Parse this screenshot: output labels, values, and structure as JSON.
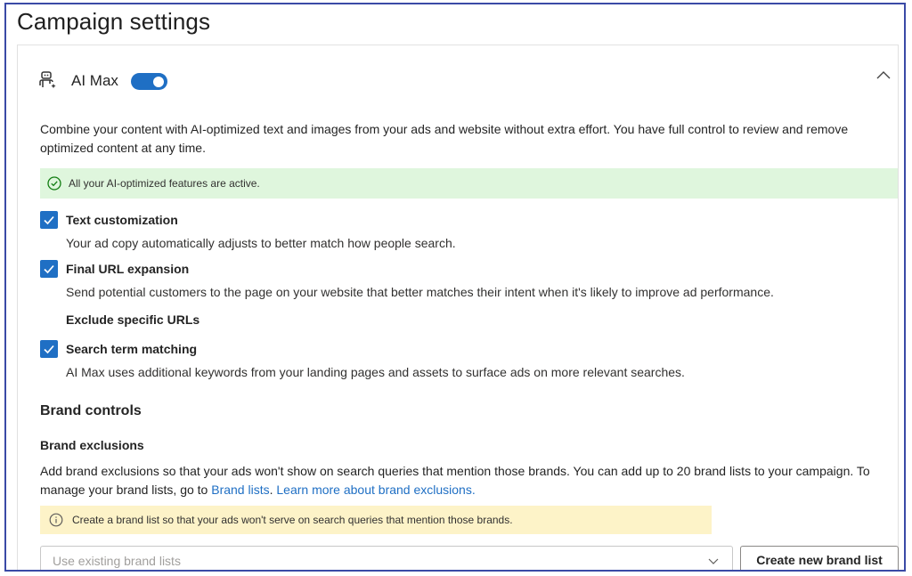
{
  "page": {
    "title": "Campaign settings"
  },
  "ai_max": {
    "label": "AI Max",
    "toggle_on": true,
    "description": "Combine your content with AI-optimized text and images from your ads and website without extra effort. You have full control to review and remove optimized content at any time.",
    "status_message": "All your AI-optimized features are active.",
    "options": [
      {
        "title": "Text customization",
        "description": "Your ad copy automatically adjusts to better match how people search.",
        "checked": true
      },
      {
        "title": "Final URL expansion",
        "description": "Send potential customers to the page on your website that better matches their intent when it's likely to improve ad performance.",
        "checked": true
      },
      {
        "title": "Search term matching",
        "description": "AI Max uses additional keywords from your landing pages and assets to surface ads on more relevant searches.",
        "checked": true
      }
    ],
    "exclude_urls_label": "Exclude specific URLs"
  },
  "brand": {
    "section_title": "Brand controls",
    "exclusions_title": "Brand exclusions",
    "desc_text": "Add brand exclusions so that your ads won't show on search queries that mention those brands. You can add up to 20 brand lists to your campaign. To manage your brand lists, go to ",
    "link_brand_lists": "Brand lists",
    "link_learn_more": "Learn more about brand exclusions.",
    "warning": "Create a brand list so that your ads won't serve on search queries that mention those brands.",
    "select_placeholder": "Use existing brand lists",
    "create_button": "Create new brand list"
  },
  "colors": {
    "accent": "#1f6fc4",
    "success_bg": "#dff6dd",
    "warning_bg": "#fdf3c8",
    "frame_border": "#3a4aa6"
  },
  "icons": {
    "ai": "robot-sparkle-icon",
    "collapse": "chevron-up-icon",
    "success": "check-circle-icon",
    "checkbox": "checkmark-icon",
    "info": "info-icon",
    "dropdown": "chevron-down-icon"
  }
}
